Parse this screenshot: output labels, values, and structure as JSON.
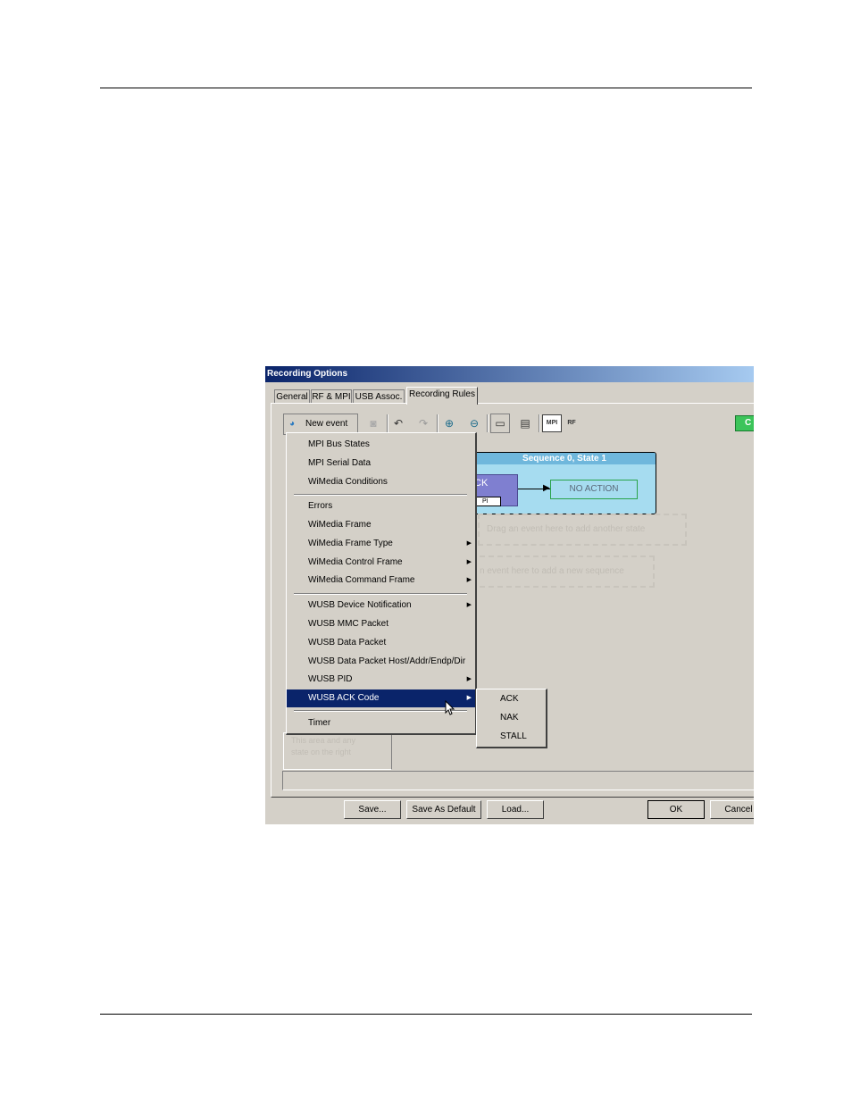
{
  "window": {
    "title": "Recording Options"
  },
  "tabs": [
    {
      "label": "General"
    },
    {
      "label": "RF & MPI"
    },
    {
      "label": "USB Assoc."
    },
    {
      "label": "Recording Rules"
    }
  ],
  "toolbar": {
    "new_event_label": "New event",
    "mpi_label": "MPI",
    "rf_label": "RF",
    "icons": [
      "new-event-icon",
      "camera-icon",
      "undo-icon",
      "redo-icon",
      "zoom-in-icon",
      "zoom-out-icon",
      "layout-icon",
      "properties-icon"
    ]
  },
  "green_button": {
    "label": "C"
  },
  "canvas": {
    "sequence_title": "Sequence 0, State 1",
    "event_label": "CK",
    "event_tag": "PI",
    "action_label": "NO ACTION",
    "drop_state_hint": "Drag an event here to add another state",
    "drop_sequence_hint": "n event here to add a new sequence",
    "left_pane_line1": "This area and any",
    "left_pane_line2": "state on the right"
  },
  "menu": {
    "items": [
      {
        "label": "MPI Bus States",
        "arrow": ""
      },
      {
        "label": "MPI Serial Data",
        "arrow": ""
      },
      {
        "label": "WiMedia Conditions",
        "arrow": ""
      },
      {
        "label": "Errors",
        "arrow": ""
      },
      {
        "label": "WiMedia Frame",
        "arrow": ""
      },
      {
        "label": "WiMedia Frame Type",
        "arrow": "▶"
      },
      {
        "label": "WiMedia Control Frame",
        "arrow": "▶"
      },
      {
        "label": "WiMedia Command Frame",
        "arrow": "▶"
      },
      {
        "label": "WUSB Device Notification",
        "arrow": "▶"
      },
      {
        "label": "WUSB MMC Packet",
        "arrow": ""
      },
      {
        "label": "WUSB Data Packet",
        "arrow": ""
      },
      {
        "label": "WUSB Data Packet Host/Addr/Endp/Dir",
        "arrow": ""
      },
      {
        "label": "WUSB PID",
        "arrow": "▶"
      },
      {
        "label": "WUSB ACK Code",
        "arrow": "▶"
      },
      {
        "label": "Timer",
        "arrow": ""
      }
    ]
  },
  "submenu": {
    "items": [
      {
        "label": "ACK"
      },
      {
        "label": "NAK"
      },
      {
        "label": "STALL"
      }
    ]
  },
  "buttons": {
    "save": "Save...",
    "save_default": "Save As Default",
    "load": "Load...",
    "ok": "OK",
    "cancel": "Cancel"
  },
  "colors": {
    "titlebar": "#0a246a",
    "selection": "#0a246a",
    "sequence_fill": "#a6dcf0",
    "event_fill": "#7f7fd0",
    "green": "#3cc45a"
  }
}
